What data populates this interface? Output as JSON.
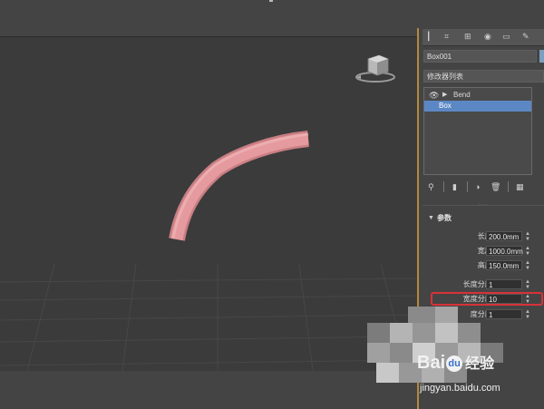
{
  "colors": {
    "viewport_bg": "#3b3b3b",
    "panel_bg": "#444444",
    "selection": "#5b88c4",
    "highlight_box": "#d8323a",
    "tube": "#e49a9e",
    "viewport_border": "#b38a3c"
  },
  "object_name": "Box001",
  "modifier_list": {
    "label": "修改器列表"
  },
  "modifier_stack": {
    "items": [
      {
        "label": "Bend",
        "eye_icon": "eye-icon",
        "expand_icon": "triangle-right-icon"
      },
      {
        "label": "Box",
        "selected": true
      }
    ]
  },
  "stack_tools": {
    "icons": [
      "pin-stack-icon",
      "show-end-result-icon",
      "make-unique-icon",
      "remove-modifier-icon",
      "configure-modifier-sets-icon"
    ]
  },
  "rollout": {
    "title": "参数",
    "params": [
      {
        "label": "长度:",
        "value": "200.0mm"
      },
      {
        "label": "宽度:",
        "value": "1000.0mm"
      },
      {
        "label": "高度:",
        "value": "150.0mm"
      },
      {
        "label": "长度分段:",
        "value": "1"
      },
      {
        "label": "宽度分段:",
        "value": "10"
      },
      {
        "label": "度分段:",
        "value": "1"
      }
    ]
  },
  "watermark": {
    "logo_text_a": "Bai",
    "logo_paw": "du",
    "logo_text_b": "经验",
    "url": "jingyan.baidu.com"
  }
}
